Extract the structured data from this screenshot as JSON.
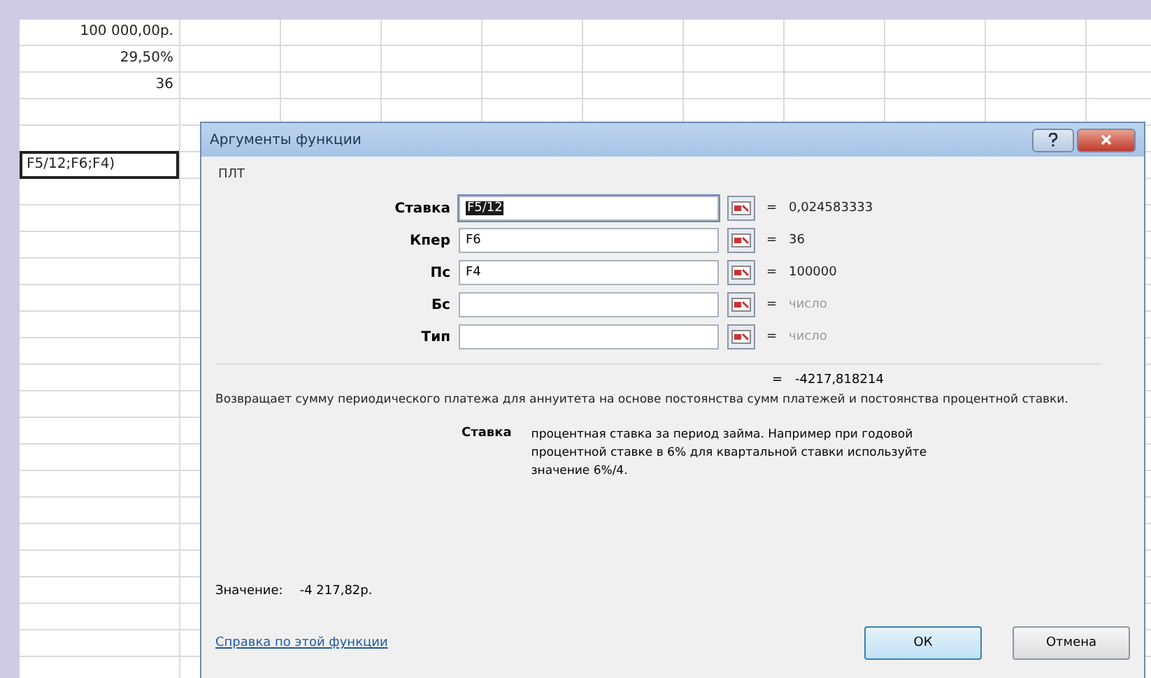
{
  "sheet": {
    "first_column": [
      {
        "text": "100 000,00р."
      },
      {
        "text": "29,50%"
      },
      {
        "text": "36"
      }
    ],
    "active_cell": {
      "text": "F5/12;F6;F4)"
    }
  },
  "dialog": {
    "title": "Аргументы функции",
    "function_name": "ПЛТ",
    "arguments": [
      {
        "label": "Ставка",
        "value": "F5/12",
        "value_selected": true,
        "equals": "=",
        "result": "0,024583333",
        "muted": false
      },
      {
        "label": "Кпер",
        "value": "F6",
        "value_selected": false,
        "equals": "=",
        "result": "36",
        "muted": false
      },
      {
        "label": "Пс",
        "value": "F4",
        "value_selected": false,
        "equals": "=",
        "result": "100000",
        "muted": false
      },
      {
        "label": "Бс",
        "equals": "=",
        "result": "число",
        "muted": true
      },
      {
        "label": "Тип",
        "equals": "=",
        "result": "число",
        "muted": true
      }
    ],
    "total_equals": "=",
    "total": "-4217,818214",
    "description": "Возвращает сумму периодического платежа для аннуитета на основе постоянства сумм платежей и постоянства процентной ставки.",
    "argument_help": {
      "label": "Ставка",
      "text": "процентная ставка за период займа. Например при годовой процентной ставке в 6% для квартальной ставки используйте значение 6%/4."
    },
    "value_label": "Значение:",
    "value": "-4 217,82р.",
    "help_link": "Справка по этой функции",
    "buttons": [
      {
        "label": "ОК",
        "default": true
      },
      {
        "label": "Отмена",
        "default": false
      }
    ]
  }
}
